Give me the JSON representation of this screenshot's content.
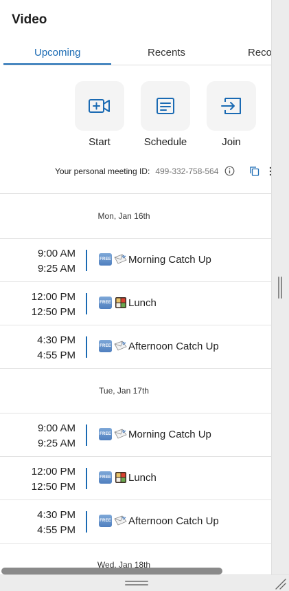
{
  "app": {
    "title": "Video"
  },
  "tabs": [
    {
      "label": "Upcoming",
      "active": true
    },
    {
      "label": "Recents",
      "active": false
    },
    {
      "label": "Reco",
      "active": false
    }
  ],
  "actions": {
    "start": {
      "label": "Start",
      "icon": "video-plus-icon"
    },
    "schedule": {
      "label": "Schedule",
      "icon": "calendar-list-icon"
    },
    "join": {
      "label": "Join",
      "icon": "join-arrow-icon"
    }
  },
  "meeting": {
    "label": "Your personal meeting ID:",
    "id": "499-332-758-564",
    "info_icon": "info-icon",
    "copy_icon": "copy-icon",
    "more_icon": "more-vertical-icon"
  },
  "days": [
    {
      "date": "Mon, Jan 16th",
      "events": [
        {
          "start": "9:00 AM",
          "end": "9:25 AM",
          "badge": "FREE",
          "emoji": "envelope",
          "title": "Morning Catch Up"
        },
        {
          "start": "12:00 PM",
          "end": "12:50 PM",
          "badge": "FREE",
          "emoji": "bento",
          "title": "Lunch"
        },
        {
          "start": "4:30 PM",
          "end": "4:55 PM",
          "badge": "FREE",
          "emoji": "envelope",
          "title": "Afternoon Catch Up"
        }
      ]
    },
    {
      "date": "Tue, Jan 17th",
      "events": [
        {
          "start": "9:00 AM",
          "end": "9:25 AM",
          "badge": "FREE",
          "emoji": "envelope",
          "title": "Morning Catch Up"
        },
        {
          "start": "12:00 PM",
          "end": "12:50 PM",
          "badge": "FREE",
          "emoji": "bento",
          "title": "Lunch"
        },
        {
          "start": "4:30 PM",
          "end": "4:55 PM",
          "badge": "FREE",
          "emoji": "envelope",
          "title": "Afternoon Catch Up"
        }
      ]
    }
  ],
  "next_day": {
    "date": "Wed, Jan 18th"
  },
  "colors": {
    "accent": "#1a6ab3",
    "tile": "#f4f4f4",
    "divider": "#e3e3e3"
  }
}
